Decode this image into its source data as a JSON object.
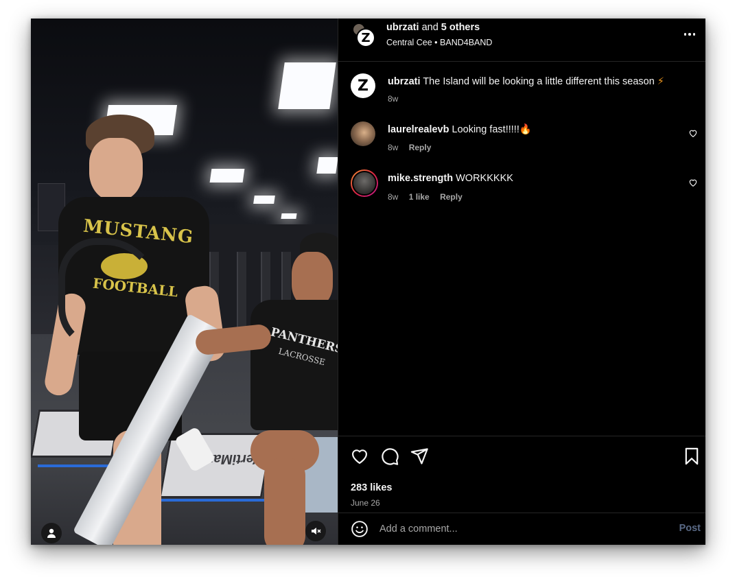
{
  "post": {
    "header": {
      "user": "ubrzati",
      "and_text": "and",
      "others_text": "5 others",
      "subtitle": "Central Cee • BAND4BAND"
    },
    "caption": {
      "user": "ubrzati",
      "text": "The Island will be looking a little different this season",
      "emoji": "⚡",
      "age": "8w"
    },
    "comments": [
      {
        "user": "laurelrealevb",
        "text": "Looking fast!!!!!",
        "emoji": "🔥",
        "age": "8w",
        "likes": "",
        "reply_label": "Reply"
      },
      {
        "user": "mike.strength",
        "text": "WORKKKKK",
        "emoji": "",
        "age": "8w",
        "likes": "1 like",
        "reply_label": "Reply"
      }
    ],
    "likes_text": "283 likes",
    "date": "June 26",
    "comment_box": {
      "placeholder": "Add a comment...",
      "post_label": "Post"
    }
  },
  "media": {
    "logo_letter": "Z",
    "shirt_text_1": "MUSTANG",
    "shirt_text_2": "FOOTBALL",
    "shirt_text_3": "PANTHERS",
    "shirt_text_4": "LACROSSE",
    "mat_text": "VertiMax"
  },
  "colors": {
    "background": "#000000",
    "text": "#f5f5f5",
    "muted": "#a8a8a8",
    "divider": "#262626",
    "post_disabled": "#5a6a86"
  },
  "icons": {
    "like": "heart-icon",
    "comment": "comment-icon",
    "share": "send-icon",
    "save": "bookmark-icon",
    "emoji": "smiley-icon",
    "more": "more-options-icon",
    "user_tag": "user-tag-icon",
    "mute": "muted-speaker-icon"
  }
}
